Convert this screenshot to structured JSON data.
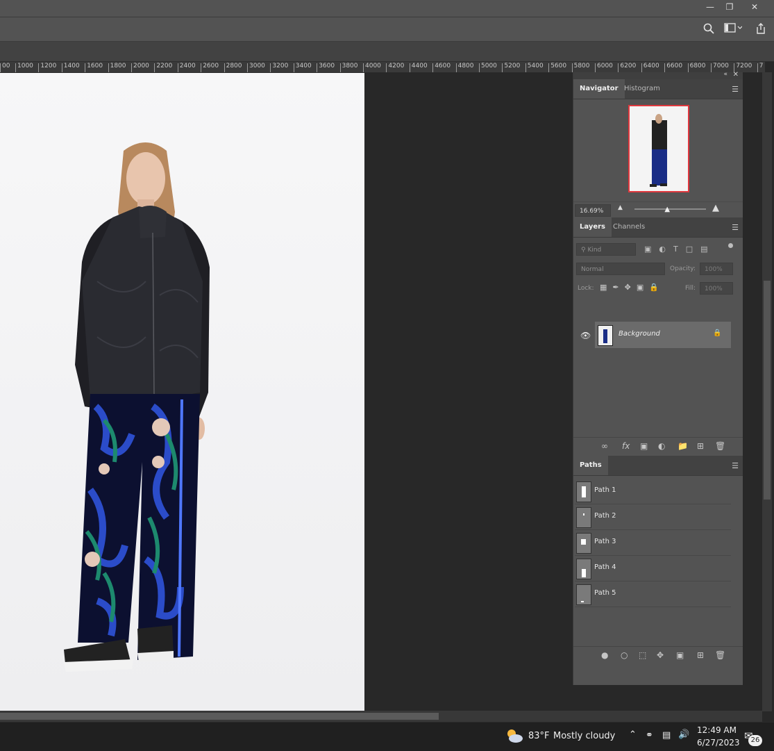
{
  "window": {
    "minimize_icon": "minimize-icon",
    "restore_icon": "restore-icon",
    "close_icon": "close-icon"
  },
  "optionsbar": {
    "search_icon": "search-icon",
    "workspace_icon": "workspace-icon",
    "share_icon": "share-icon"
  },
  "ruler": {
    "ticks": [
      "00",
      "1000",
      "1200",
      "1400",
      "1600",
      "1800",
      "2000",
      "2200",
      "2400",
      "2600",
      "2800",
      "3000",
      "3200",
      "3400",
      "3600",
      "3800",
      "4000",
      "4200",
      "4400",
      "4600",
      "4800",
      "5000",
      "5200",
      "5400",
      "5600",
      "5800",
      "6000",
      "6200",
      "6400",
      "6600",
      "6800",
      "7000",
      "7200",
      "7"
    ]
  },
  "navigator": {
    "tabs": [
      "Navigator",
      "Histogram"
    ],
    "zoom": "16.69%",
    "zoom_slider_fraction": 0.47
  },
  "layers": {
    "tabs": [
      "Layers",
      "Channels"
    ],
    "filter_placeholder": "Kind",
    "blend_mode": "Normal",
    "opacity_label": "Opacity:",
    "opacity_value": "100%",
    "lock_label": "Lock:",
    "fill_label": "Fill:",
    "fill_value": "100%",
    "items": [
      {
        "name": "Background",
        "visible": true,
        "locked": true
      }
    ]
  },
  "paths": {
    "tab": "Paths",
    "items": [
      "Path 1",
      "Path 2",
      "Path 3",
      "Path 4",
      "Path 5"
    ]
  },
  "taskbar": {
    "weather_temp": "83°F",
    "weather_desc": "Mostly cloudy",
    "time": "12:49 AM",
    "date": "6/27/2023",
    "notification_count": "26"
  },
  "colors": {
    "accent_red": "#e0383e",
    "panel_bg": "#535353",
    "canvas_bg": "#282828"
  }
}
